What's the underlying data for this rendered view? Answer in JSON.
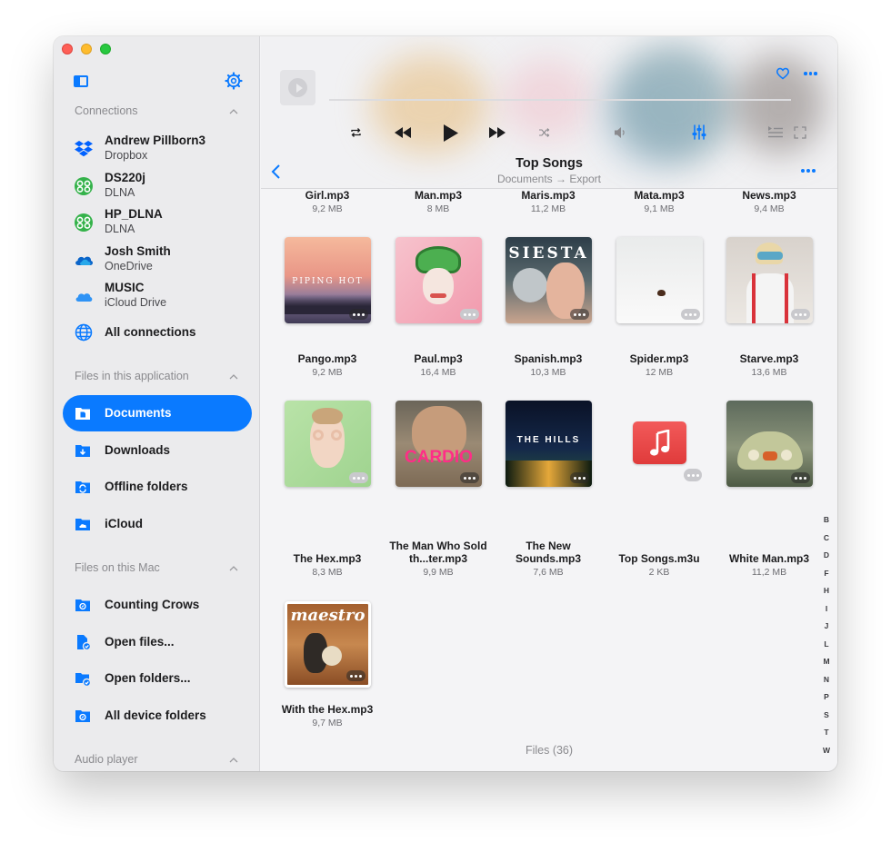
{
  "sidebar": {
    "sections": {
      "connections": "Connections",
      "files_app": "Files in this application",
      "files_mac": "Files on this Mac",
      "audio_player": "Audio player"
    },
    "connections": [
      {
        "name": "Andrew Pillborn3",
        "service": "Dropbox",
        "icon": "dropbox-icon"
      },
      {
        "name": "DS220j",
        "service": "DLNA",
        "icon": "dlna-icon"
      },
      {
        "name": "HP_DLNA",
        "service": "DLNA",
        "icon": "dlna-icon"
      },
      {
        "name": "Josh Smith",
        "service": "OneDrive",
        "icon": "onedrive-icon"
      },
      {
        "name": "MUSIC",
        "service": "iCloud Drive",
        "icon": "icloud-icon"
      }
    ],
    "all_connections": "All connections",
    "app_items": [
      "Documents",
      "Downloads",
      "Offline folders",
      "iCloud"
    ],
    "mac_items": [
      "Counting Crows",
      "Open files...",
      "Open folders...",
      "All device folders"
    ],
    "accent": "#0a7aff"
  },
  "header": {
    "title": "Top Songs",
    "breadcrumb": "Documents → Export"
  },
  "files": {
    "top_row": [
      {
        "name": "Girl.mp3",
        "size": "9,2 MB"
      },
      {
        "name": "Man.mp3",
        "size": "8 MB"
      },
      {
        "name": "Maris.mp3",
        "size": "11,2 MB"
      },
      {
        "name": "Mata.mp3",
        "size": "9,1 MB"
      },
      {
        "name": "News.mp3",
        "size": "9,4 MB"
      }
    ],
    "items": [
      {
        "name": "Pango.mp3",
        "size": "9,2 MB",
        "cover_text": "PIPING HOT"
      },
      {
        "name": "Paul.mp3",
        "size": "16,4 MB",
        "cover_text": ""
      },
      {
        "name": "Spanish.mp3",
        "size": "10,3 MB",
        "cover_text": "SIESTA"
      },
      {
        "name": "Spider.mp3",
        "size": "12 MB",
        "cover_text": ""
      },
      {
        "name": "Starve.mp3",
        "size": "13,6 MB",
        "cover_text": ""
      },
      {
        "name": "The Hex.mp3",
        "size": "8,3 MB",
        "cover_text": ""
      },
      {
        "name": "The Man Who Sold th...ter.mp3",
        "size": "9,9 MB",
        "cover_text": "CARDIO"
      },
      {
        "name": "The New Sounds.mp3",
        "size": "7,6 MB",
        "cover_text": "THE HILLS"
      },
      {
        "name": "Top Songs.m3u",
        "size": "2 KB",
        "cover_text": ""
      },
      {
        "name": "White Man.mp3",
        "size": "11,2 MB",
        "cover_text": ""
      },
      {
        "name": "With the Hex.mp3",
        "size": "9,7 MB",
        "cover_text": "maestro"
      }
    ],
    "count_label": "Files (36)"
  },
  "az_index": [
    "B",
    "C",
    "D",
    "F",
    "H",
    "I",
    "J",
    "L",
    "M",
    "N",
    "P",
    "S",
    "T",
    "W"
  ]
}
